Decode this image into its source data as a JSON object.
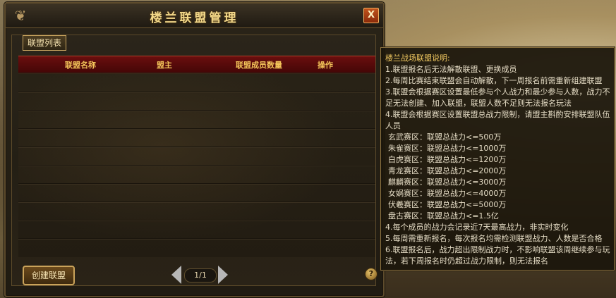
{
  "window": {
    "title": "楼兰联盟管理",
    "close_label": "X"
  },
  "tabs": [
    {
      "label": "联盟列表"
    }
  ],
  "table": {
    "headers": [
      "联盟名称",
      "盟主",
      "联盟成员数量",
      "操作"
    ],
    "rows": []
  },
  "footer": {
    "create_button": "创建联盟",
    "page_text": "1/1",
    "help_label": "?"
  },
  "info": {
    "title": "楼兰战场联盟说明:",
    "lines": [
      "1.联盟报名后无法解散联盟、更换成员",
      "2.每周比赛结束联盟会自动解散，下一周报名前需重新组建联盟",
      "3.联盟会根据赛区设置最低参与个人战力和最少参与人数，战力不",
      "足无法创建、加入联盟，联盟人数不足则无法报名玩法",
      "4.联盟会根据赛区设置联盟总战力限制，请盟主斟酌安排联盟队伍",
      "人员",
      "玄武赛区：联盟总战力<=500万",
      "朱雀赛区：联盟总战力<=1000万",
      "白虎赛区：联盟总战力<=1200万",
      "青龙赛区：联盟总战力<=2000万",
      "麒麟赛区：联盟总战力<=3000万",
      "女娲赛区：联盟总战力<=4000万",
      "伏羲赛区：联盟总战力<=5000万",
      "盘古赛区：联盟总战力<=1.5亿",
      "4.每个成员的战力会记录近7天最高战力，非实时变化",
      "5.每周需重新报名，每次报名均需检测联盟战力、人数是否合格",
      "6.联盟报名后，战力超出限制战力时，不影响联盟该周继续参与玩",
      "法，若下周报名时仍超过战力限制，则无法报名"
    ]
  },
  "colors": {
    "title_gold": "#f3d889",
    "header_red": "#6a0e0e",
    "header_text": "#f3c45a",
    "info_highlight": "#f0c860"
  }
}
